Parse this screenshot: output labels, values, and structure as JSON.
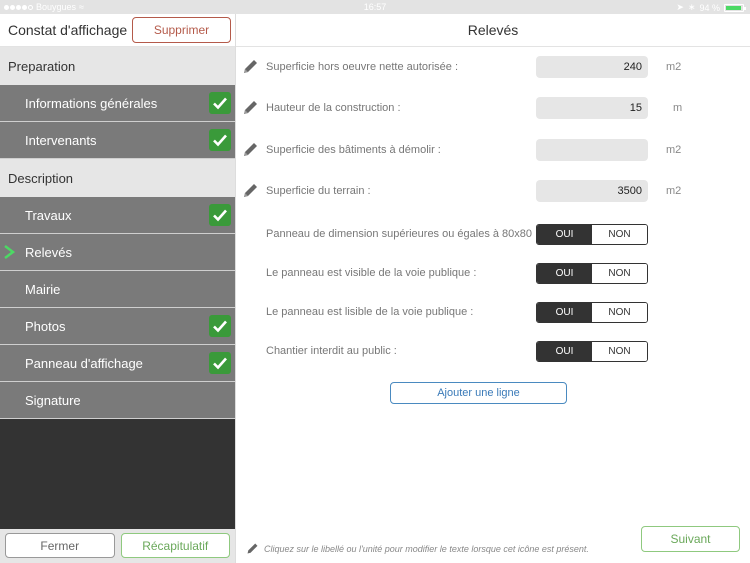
{
  "status_bar": {
    "carrier": "Bouygues",
    "time": "16:57",
    "battery": "94 %",
    "battery_level": 0.94
  },
  "sidebar": {
    "title": "Constat d'affichage",
    "delete_label": "Supprimer",
    "sections": [
      {
        "label": "Preparation",
        "items": [
          {
            "label": "Informations générales",
            "checked": true
          },
          {
            "label": "Intervenants",
            "checked": true
          }
        ]
      },
      {
        "label": "Description",
        "items": [
          {
            "label": "Travaux",
            "checked": true
          },
          {
            "label": "Relevés",
            "checked": false,
            "selected": true
          },
          {
            "label": "Mairie",
            "checked": false
          },
          {
            "label": "Photos",
            "checked": true
          },
          {
            "label": "Panneau d'affichage",
            "checked": true
          },
          {
            "label": "Signature",
            "checked": false
          }
        ]
      }
    ],
    "footer": {
      "close_label": "Fermer",
      "summary_label": "Récapitulatif"
    }
  },
  "main": {
    "title": "Relevés",
    "fields": [
      {
        "label": "Superficie hors oeuvre nette autorisée :",
        "value": "240",
        "unit": "m2"
      },
      {
        "label": "Hauteur de la construction :",
        "value": "15",
        "unit": "m"
      },
      {
        "label": "Superficie des bâtiments à démolir :",
        "value": "",
        "unit": "m2"
      },
      {
        "label": "Superficie du terrain :",
        "value": "3500",
        "unit": "m2"
      }
    ],
    "toggles": [
      {
        "label": "Panneau de dimension supérieures ou égales à 80x80 :",
        "yes": "OUI",
        "no": "NON",
        "selected": "OUI"
      },
      {
        "label": "Le panneau est visible de la voie publique :",
        "yes": "OUI",
        "no": "NON",
        "selected": "OUI"
      },
      {
        "label": "Le panneau est lisible de la voie publique :",
        "yes": "OUI",
        "no": "NON",
        "selected": "OUI"
      },
      {
        "label": "Chantier interdit au public :",
        "yes": "OUI",
        "no": "NON",
        "selected": "OUI"
      }
    ],
    "add_line_label": "Ajouter une ligne",
    "hint": "Cliquez sur le libellé ou l'unité pour modifier le texte lorsque cet icône est présent.",
    "next_label": "Suivant"
  },
  "colors": {
    "accent_green": "#6aa85a",
    "check_green": "#3a9a3a",
    "delete_red": "#b45a4a",
    "link_blue": "#3a7ab8",
    "selected_chevron": "#4cd964"
  }
}
